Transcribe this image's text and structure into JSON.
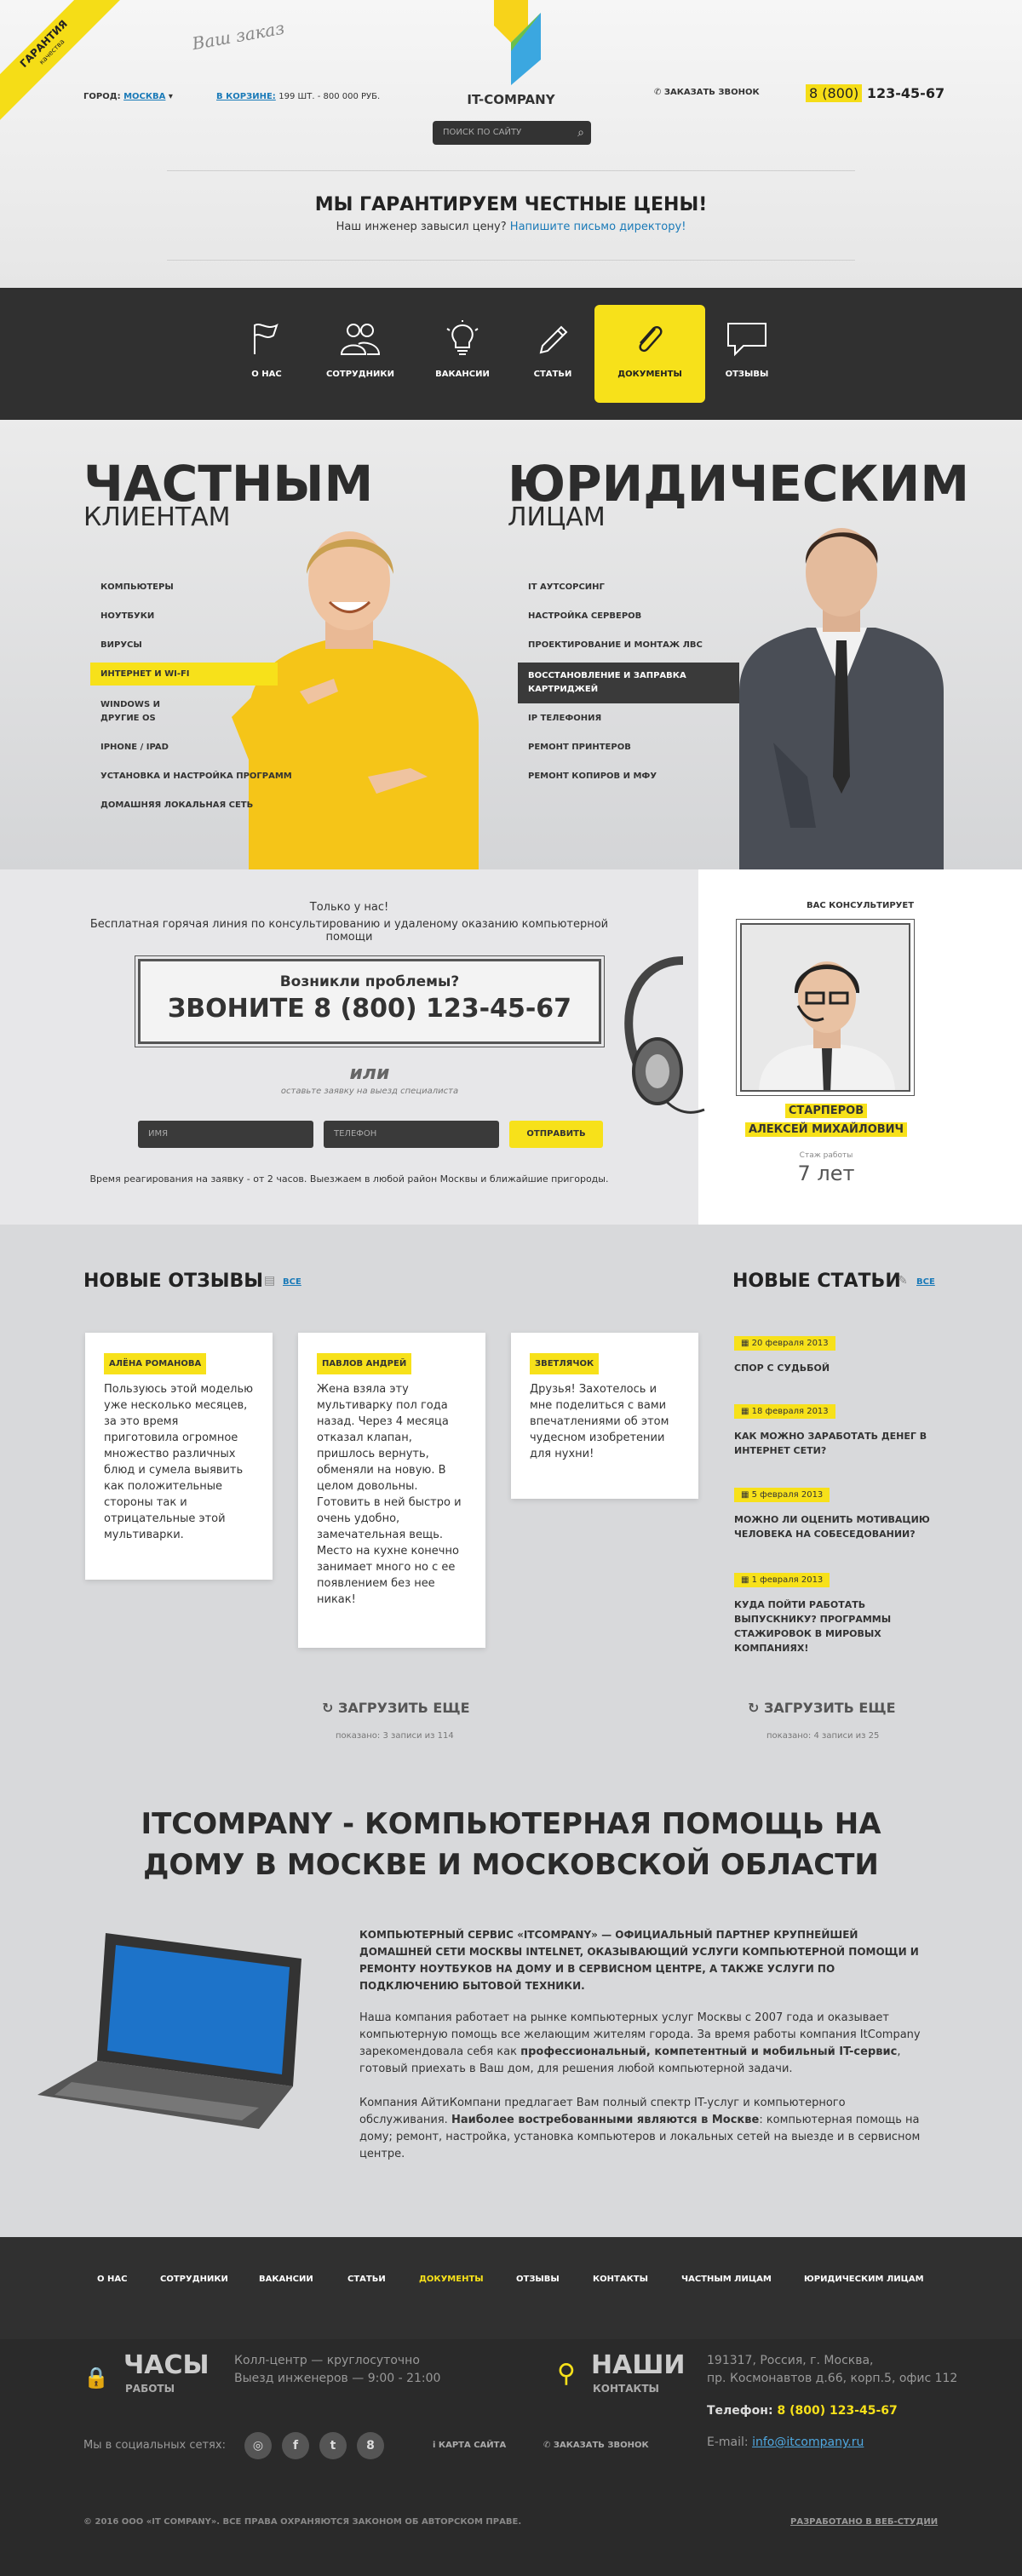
{
  "ribbon": {
    "title": "ГАРАНТИЯ",
    "sub": "качества"
  },
  "signature": "Ваш заказ",
  "city": {
    "label": "ГОРОД:",
    "value": "МОСКВА"
  },
  "cart": {
    "label": "В КОРЗИНЕ:",
    "value": "199 ШТ. - 800 000 РУБ."
  },
  "logo": "IT-COMPANY",
  "search": {
    "placeholder": "ПОИСК ПО САЙТУ"
  },
  "callback": "ЗАКАЗАТЬ ЗВОНОК",
  "phone": {
    "code": "8 (800)",
    "number": "123-45-67"
  },
  "guarantee": {
    "title": "МЫ ГАРАНТИРУЕМ ЧЕСТНЫЕ ЦЕНЫ!",
    "text": "Наш инженер завысил цену?",
    "link": "Напишите письмо директору!"
  },
  "nav": [
    {
      "label": "О НАС",
      "icon": "flag-icon"
    },
    {
      "label": "СОТРУДНИКИ",
      "icon": "people-icon"
    },
    {
      "label": "ВАКАНСИИ",
      "icon": "lightbulb-icon"
    },
    {
      "label": "СТАТЬИ",
      "icon": "pencil-icon"
    },
    {
      "label": "ДОКУМЕНТЫ",
      "icon": "paperclip-icon"
    },
    {
      "label": "ОТЗЫВЫ",
      "icon": "speech-bubble-icon"
    }
  ],
  "private": {
    "title": "ЧАСТНЫМ",
    "sub": "КЛИЕНТАМ",
    "items": [
      "КОМПЬЮТЕРЫ",
      "НОУТБУКИ",
      "ВИРУСЫ",
      "ИНТЕРНЕТ И WI-FI",
      "WINDOWS И ДРУГИЕ OS",
      "IPHONE / IPAD",
      "УСТАНОВКА И НАСТРОЙКА ПРОГРАММ",
      "ДОМАШНЯЯ ЛОКАЛЬНАЯ СЕТЬ"
    ]
  },
  "legal": {
    "title": "ЮРИДИЧЕСКИМ",
    "sub": "ЛИЦАМ",
    "items": [
      "IT АУТСОРСИНГ",
      "НАСТРОЙКА СЕРВЕРОВ",
      "ПРОЕКТИРОВАНИЕ И МОНТАЖ ЛВС",
      "ВОССТАНОВЛЕНИЕ И ЗАПРАВКА КАРТРИДЖЕЙ",
      "IP ТЕЛЕФОНИЯ",
      "РЕМОНТ ПРИНТЕРОВ",
      "РЕМОНТ КОПИРОВ И МФУ"
    ]
  },
  "consult": {
    "only": "Только у нас!",
    "line": "Бесплатная горячая линия по консультированию и удаленому оказанию компьютерной помощи",
    "problem": "Возникли проблемы?",
    "call": "ЗВОНИТЕ 8 (800) 123-45-67",
    "or": "или",
    "or_sub": "оставьте заявку на выезд специалиста",
    "name_ph": "ИМЯ",
    "phone_ph": "ТЕЛЕФОН",
    "send": "ОТПРАВИТЬ",
    "note": "Время реагирования на заявку - от 2 часов. Выезжаем в любой район Москвы и ближайшие пригороды.",
    "adv_title": "ВАС КОНСУЛЬТИРУЕТ",
    "adv_line1": "СТАРПЕРОВ",
    "adv_line2": "АЛЕКСЕЙ МИХАЙЛОВИЧ",
    "exp_label": "Стаж работы",
    "exp_value": "7 лет"
  },
  "reviews": {
    "title": "НОВЫЕ ОТЗЫВЫ",
    "all": "ВСЕ",
    "items": [
      {
        "name": "АЛЁНА РОМАНОВА",
        "text": "Пользуюсь этой моделью уже несколько месяцев, за это время приготовила огромное множество различных блюд и сумела выявить как положительные стороны так и отрицательные этой мультиварки."
      },
      {
        "name": "ПАВЛОВ АНДРЕЙ",
        "text": "Жена взяла эту мультиварку пол года назад. Через 4 месяца отказал клапан, пришлось вернуть, обменяли на новую. В целом довольны. Готовить в ней быстро и очень удобно, замечательная вещь. Место на кухне конечно занимает много но с ее появлением без нее никак!"
      },
      {
        "name": "ЗВЕТЛЯЧОК",
        "text": "Друзья! Захотелось и мне поделиться с вами впечатлениями об этом чудесном изобретении для нухни!"
      }
    ],
    "load": "ЗАГРУЗИТЬ ЕЩЕ",
    "shown": "показано: 3 записи из 114"
  },
  "articles": {
    "title": "НОВЫЕ СТАТЬИ",
    "all": "ВСЕ",
    "items": [
      {
        "date": "20 февраля 2013",
        "title": "СПОР С СУДЬБОЙ"
      },
      {
        "date": "18 февраля 2013",
        "title": "КАК МОЖНО ЗАРАБОТАТЬ ДЕНЕГ В ИНТЕРНЕТ СЕТИ?"
      },
      {
        "date": "5 февраля 2013",
        "title": "МОЖНО ЛИ ОЦЕНИТЬ МОТИВАЦИЮ ЧЕЛОВЕКА НА СОБЕСЕДОВАНИИ?"
      },
      {
        "date": "1 февраля 2013",
        "title": "КУДА ПОЙТИ РАБОТАТЬ ВЫПУСКНИКУ? ПРОГРАММЫ СТАЖИРОВОК В МИРОВЫХ КОМПАНИЯХ!"
      }
    ],
    "load": "ЗАГРУЗИТЬ ЕЩЕ",
    "shown": "показано: 4 записи из 25"
  },
  "about": {
    "title": "ITCOMPANY - КОМПЬЮТЕРНАЯ ПОМОЩЬ НА ДОМУ В МОСКВЕ И МОСКОВСКОЙ ОБЛАСТИ",
    "lead": "КОМПЬЮТЕРНЫЙ СЕРВИС «ITCOMPANY» — ОФИЦИАЛЬНЫЙ ПАРТНЕР КРУПНЕЙШЕЙ ДОМАШНЕЙ СЕТИ МОСКВЫ INTELNET, ОКАЗЫВАЮЩИЙ УСЛУГИ КОМПЬЮТЕРНОЙ ПОМОЩИ И РЕМОНТУ НОУТБУКОВ НА ДОМУ И В СЕРВИСНОМ ЦЕНТРЕ, А ТАКЖЕ УСЛУГИ ПО ПОДКЛЮЧЕНИЮ БЫТОВОЙ ТЕХНИКИ.",
    "p1a": "Наша компания работает на рынке компьютерных услуг Москвы с 2007 года и оказывает компьютерную помощь все желающим жителям города. За время работы компания ItCompany зарекомендовала себя как ",
    "p1b": "профессиональный, компетентный и мобильный IT-сервис",
    "p1c": ", готовый приехать в Ваш дом, для решения любой компьютерной задачи.",
    "p2a": "Компания АйтиКомпани предлагает Вам полный спектр IT-услуг и компьютерного обслуживания. ",
    "p2b": "Наиболее востребованными являются в Москве",
    "p2c": ": компьютерная помощь на дому; ремонт, настройка, установка компьютеров и локальных сетей на выезде и в сервисном центре."
  },
  "footer_nav": [
    "О НАС",
    "СОТРУДНИКИ",
    "ВАКАНСИИ",
    "СТАТЬИ",
    "ДОКУМЕНТЫ",
    "ОТЗЫВЫ",
    "КОНТАКТЫ",
    "ЧАСТНЫМ ЛИЦАМ",
    "ЮРИДИЧЕСКИМ ЛИЦАМ"
  ],
  "footer": {
    "hours_title": "ЧАСЫ",
    "hours_sub": "РАБОТЫ",
    "hours1": "Колл-центр — круглосуточно",
    "hours2": "Выезд инженеров — 9:00 - 21:00",
    "contacts_title": "НАШИ",
    "contacts_sub": "КОНТАКТЫ",
    "addr1": "191317, Россия, г. Москва,",
    "addr2": "пр. Космонавтов д.66, корп.5, офис 112",
    "phone_label": "Телефон:",
    "phone": "8 (800) 123-45-67",
    "email_label": "E-mail:",
    "email": "info@itcompany.ru",
    "social": "Мы в социальных сетях:",
    "sitemap": "КАРТА САЙТА",
    "callback": "ЗАКАЗАТЬ ЗВОНОК",
    "copyright": "© 2016 ООО «IT COMPANY». ВСЕ ПРАВА ОХРАНЯЮТСЯ ЗАКОНОМ ОБ АВТОРСКОМ ПРАВЕ.",
    "dev": "РАЗРАБОТАНО В ВЕБ-СТУДИИ"
  },
  "colors": {
    "accent": "#f7e11a",
    "dark": "#303030",
    "link": "#1a7ab8"
  }
}
